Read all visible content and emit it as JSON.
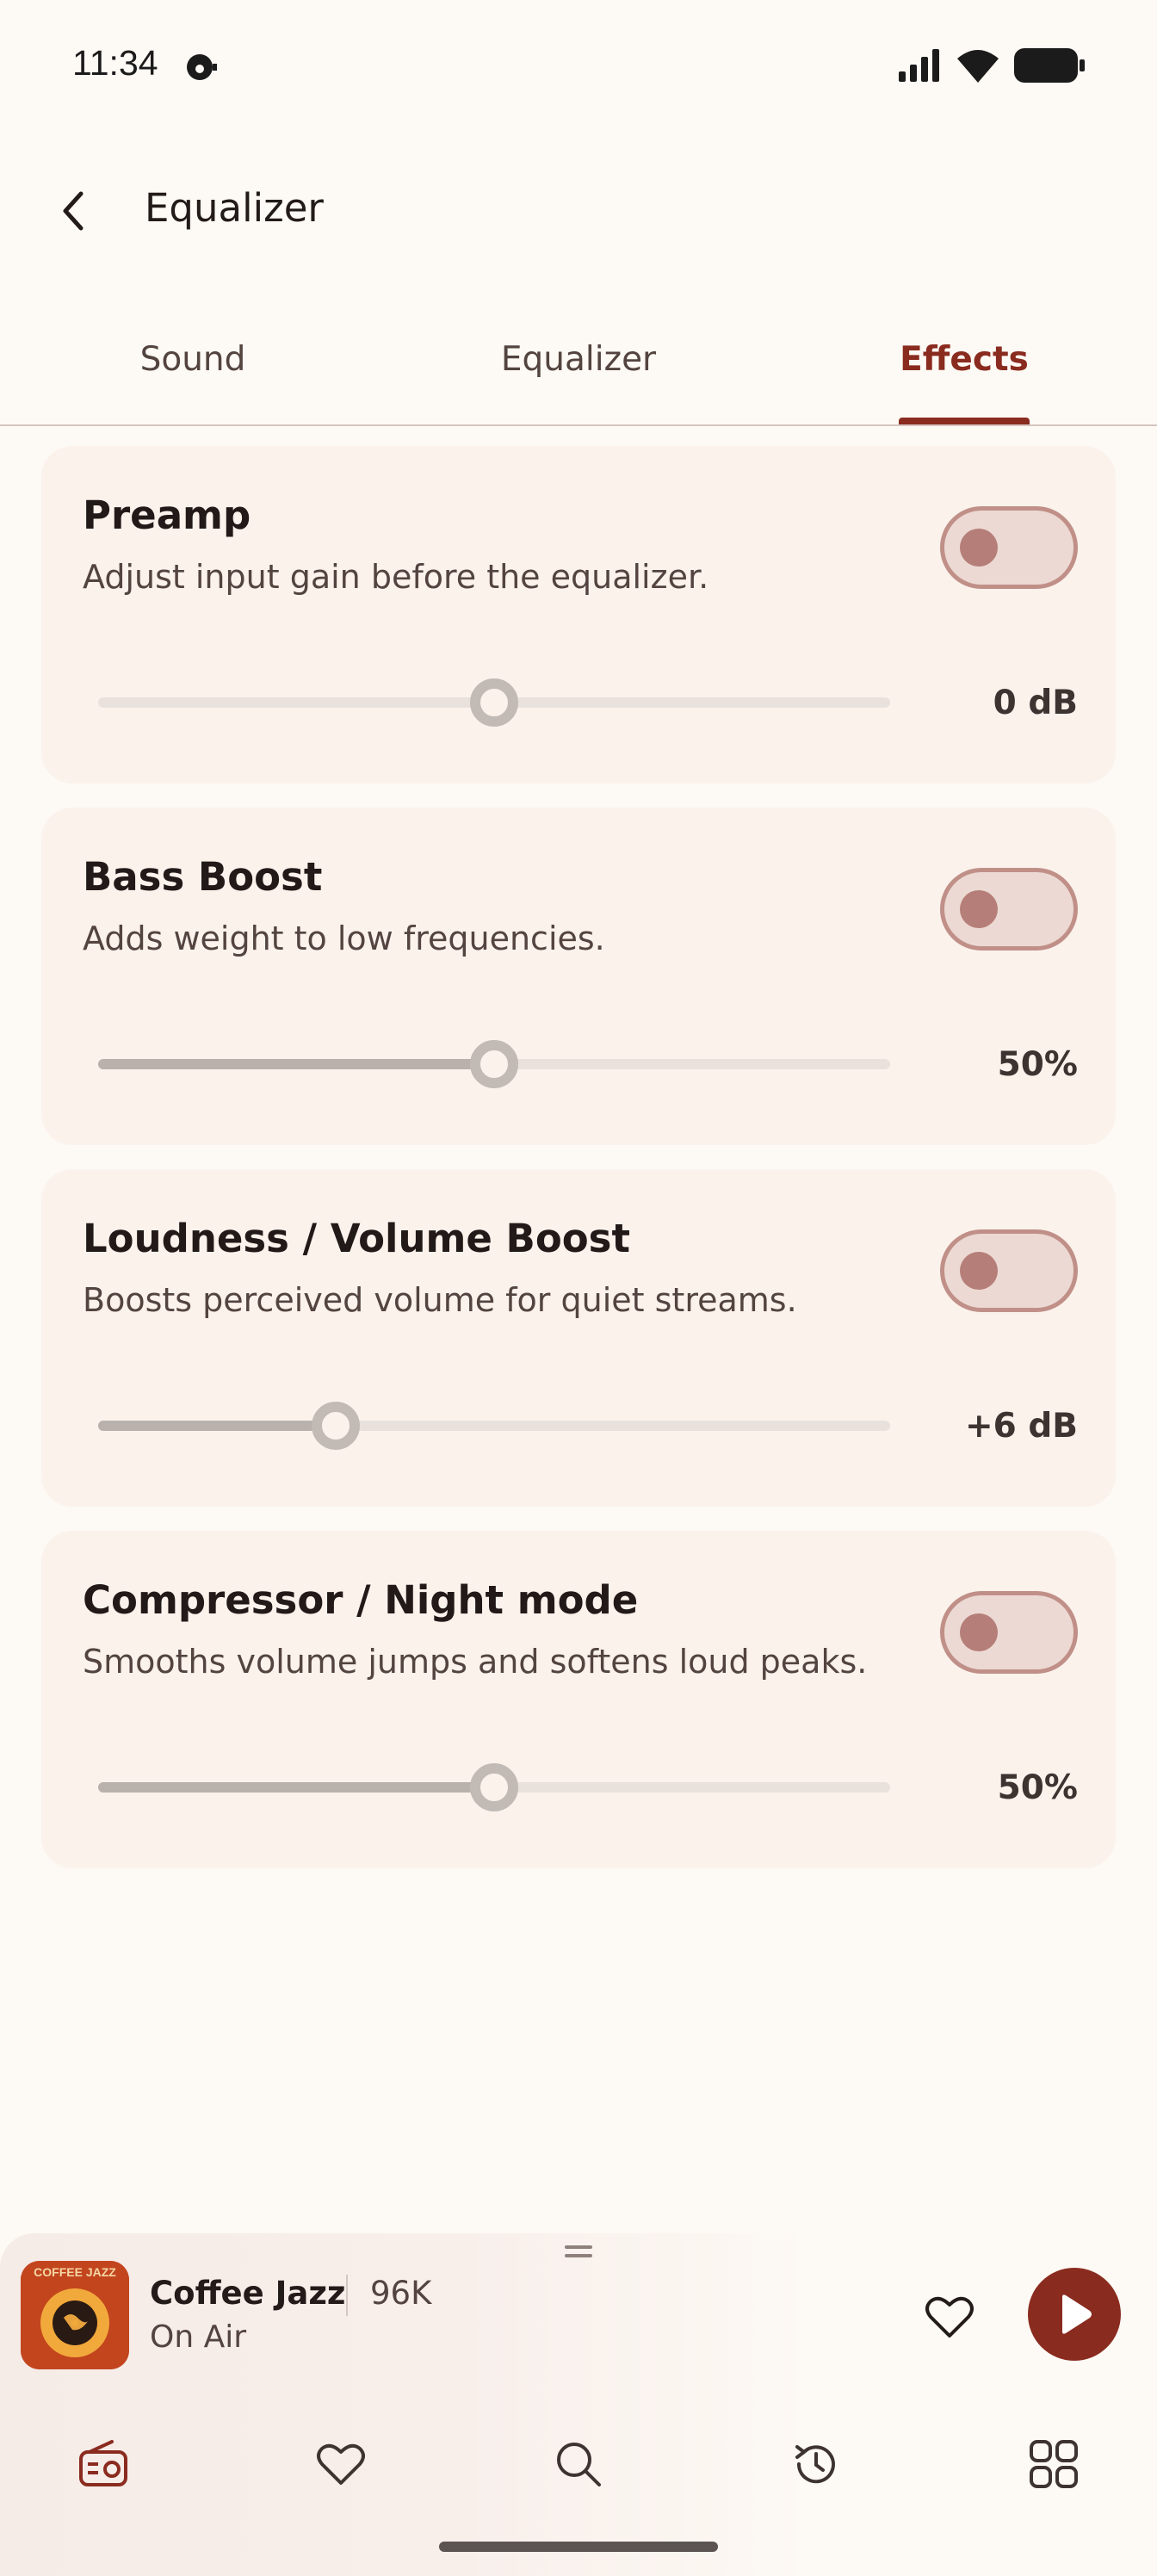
{
  "status_bar": {
    "time": "11:34",
    "icons": [
      "notification-dot-icon",
      "signal-icon",
      "wifi-icon",
      "battery-icon"
    ]
  },
  "header": {
    "title": "Equalizer",
    "back_icon": "chevron-left-icon"
  },
  "tabs": [
    {
      "label": "Sound",
      "selected": false
    },
    {
      "label": "Equalizer",
      "selected": false
    },
    {
      "label": "Effects",
      "selected": true
    }
  ],
  "effects": [
    {
      "title": "Preamp",
      "description": "Adjust input gain before the equalizer.",
      "enabled": false,
      "value_label": "0 dB",
      "level": 0.5,
      "filled": false
    },
    {
      "title": "Bass Boost",
      "description": "Adds weight to low frequencies.",
      "enabled": false,
      "value_label": "50%",
      "level": 0.5,
      "filled": true
    },
    {
      "title": "Loudness / Volume Boost",
      "description": "Boosts perceived volume for quiet streams.",
      "enabled": false,
      "value_label": "+6 dB",
      "level": 0.3,
      "filled": true
    },
    {
      "title": "Compressor / Night mode",
      "description": "Smooths volume jumps and softens loud peaks.",
      "enabled": false,
      "value_label": "50%",
      "level": 0.5,
      "filled": true
    }
  ],
  "player": {
    "artwork_text": "COFFEE JAZZ",
    "station": "Coffee Jazz",
    "listeners": "96K",
    "status": "On Air",
    "favorite_icon": "heart-outline-icon",
    "play_icon": "play-icon"
  },
  "bottom_nav": [
    {
      "icon": "radio-icon",
      "selected": true
    },
    {
      "icon": "heart-icon",
      "selected": false
    },
    {
      "icon": "search-icon",
      "selected": false
    },
    {
      "icon": "history-icon",
      "selected": false
    },
    {
      "icon": "grid-icon",
      "selected": false
    }
  ],
  "colors": {
    "background": "#fdf9f4",
    "accent": "#8a2b1f",
    "card": "#fbf2ec",
    "toggle_off_track": "#ecd9d3",
    "toggle_off_knob": "#b57e78"
  }
}
